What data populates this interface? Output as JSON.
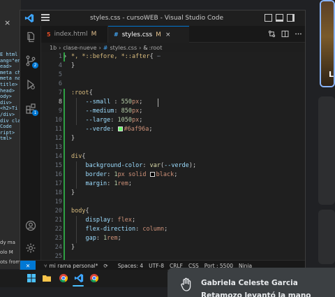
{
  "window": {
    "title": "styles.css - cursoWEB - Visual Studio Code"
  },
  "background_left": {
    "tab_close": "×",
    "code_snippets": [
      "E html",
      "ang=\"en",
      "ead>",
      "meta ch",
      "meta na",
      "title>",
      "head>",
      "ody>",
      "div>",
      "<h2>Ti",
      "/div>",
      "div cla",
      " Code",
      "ript>",
      "tml>"
    ],
    "bottom_texts": [
      "dy  ma",
      "olo  M",
      "ots from t"
    ]
  },
  "tabs": [
    {
      "label": "index.html",
      "modified": "M",
      "icon": "html-file-icon",
      "icon_glyph": "5",
      "icon_color": "#e44d26"
    },
    {
      "label": "styles.css",
      "modified": "M",
      "icon": "css-file-icon",
      "icon_glyph": "#",
      "icon_color": "#42a5f5",
      "close": "×"
    }
  ],
  "breadcrumb": {
    "items": [
      "1b",
      "clase-nueve",
      "styles.css",
      ":root"
    ],
    "sep": "›",
    "css_hash": "#",
    "selector_icon": "&"
  },
  "editor": {
    "active_line": 8,
    "lines": [
      {
        "n": "1",
        "parts": [
          [
            "tok-sel",
            "*, *::before, *::after"
          ],
          [
            "tok-punc",
            "{"
          ],
          [
            "tok-fold",
            " ⋯"
          ]
        ]
      },
      {
        "n": "4",
        "parts": [
          [
            "tok-punc",
            "}"
          ]
        ]
      },
      {
        "n": "5",
        "parts": []
      },
      {
        "n": "6",
        "parts": []
      },
      {
        "n": "7",
        "parts": [
          [
            "tok-sel",
            ":root"
          ],
          [
            "tok-punc",
            "{"
          ]
        ]
      },
      {
        "n": "8",
        "parts": [
          [
            "tok-prop",
            "    --small"
          ],
          [
            "tok-punc",
            " : "
          ],
          [
            "tok-num",
            "550"
          ],
          [
            "tok-val",
            "px"
          ],
          [
            "tok-punc",
            ";"
          ]
        ]
      },
      {
        "n": "9",
        "parts": [
          [
            "tok-prop",
            "    --medium"
          ],
          [
            "tok-punc",
            ": "
          ],
          [
            "tok-num",
            "850"
          ],
          [
            "tok-val",
            "px"
          ],
          [
            "tok-punc",
            ";"
          ]
        ]
      },
      {
        "n": "10",
        "parts": [
          [
            "tok-prop",
            "    --large"
          ],
          [
            "tok-punc",
            ": "
          ],
          [
            "tok-num",
            "1050"
          ],
          [
            "tok-val",
            "px"
          ],
          [
            "tok-punc",
            ";"
          ]
        ]
      },
      {
        "n": "11",
        "parts": [
          [
            "tok-prop",
            "    --verde"
          ],
          [
            "tok-punc",
            ": "
          ],
          [
            "swatch",
            "#6af96a"
          ],
          [
            "tok-val",
            "#6af96a"
          ],
          [
            "tok-punc",
            ";"
          ]
        ]
      },
      {
        "n": "12",
        "parts": [
          [
            "tok-punc",
            "}"
          ]
        ]
      },
      {
        "n": "13",
        "parts": []
      },
      {
        "n": "14",
        "parts": [
          [
            "tok-sel",
            "div"
          ],
          [
            "tok-punc",
            "{"
          ]
        ]
      },
      {
        "n": "15",
        "parts": [
          [
            "tok-prop",
            "    background-color"
          ],
          [
            "tok-punc",
            ": "
          ],
          [
            "tok-fn",
            "var"
          ],
          [
            "tok-punc",
            "("
          ],
          [
            "tok-prop",
            "--verde"
          ],
          [
            "tok-punc",
            ");"
          ]
        ]
      },
      {
        "n": "16",
        "parts": [
          [
            "tok-prop",
            "    border"
          ],
          [
            "tok-punc",
            ": "
          ],
          [
            "tok-num",
            "1"
          ],
          [
            "tok-val",
            "px solid "
          ],
          [
            "swatch",
            "#000000"
          ],
          [
            "tok-val",
            "black"
          ],
          [
            "tok-punc",
            ";"
          ]
        ]
      },
      {
        "n": "17",
        "parts": [
          [
            "tok-prop",
            "    margin"
          ],
          [
            "tok-punc",
            ": "
          ],
          [
            "tok-num",
            "1"
          ],
          [
            "tok-val",
            "rem"
          ],
          [
            "tok-punc",
            ";"
          ]
        ]
      },
      {
        "n": "18",
        "parts": [
          [
            "tok-punc",
            "}"
          ]
        ]
      },
      {
        "n": "19",
        "parts": []
      },
      {
        "n": "20",
        "parts": [
          [
            "tok-sel",
            "body"
          ],
          [
            "tok-punc",
            "{"
          ]
        ]
      },
      {
        "n": "21",
        "parts": [
          [
            "tok-prop",
            "    display"
          ],
          [
            "tok-punc",
            ": "
          ],
          [
            "tok-val",
            "flex"
          ],
          [
            "tok-punc",
            ";"
          ]
        ]
      },
      {
        "n": "22",
        "parts": [
          [
            "tok-prop",
            "    flex-direction"
          ],
          [
            "tok-punc",
            ": "
          ],
          [
            "tok-val",
            "column"
          ],
          [
            "tok-punc",
            ";"
          ]
        ]
      },
      {
        "n": "23",
        "parts": [
          [
            "tok-prop",
            "    gap"
          ],
          [
            "tok-punc",
            ": "
          ],
          [
            "tok-num",
            "1"
          ],
          [
            "tok-val",
            "rem"
          ],
          [
            "tok-punc",
            ";"
          ]
        ]
      },
      {
        "n": "24",
        "parts": [
          [
            "tok-punc",
            "}"
          ]
        ]
      },
      {
        "n": "25",
        "parts": []
      }
    ]
  },
  "statusbar": {
    "remote": "✕",
    "branch": "mi rama personal*",
    "sync": "⟳",
    "spaces": "Spaces: 4",
    "encoding": "UTF-8",
    "eol": "CRLF",
    "language": "CSS",
    "port": "Port : 5500",
    "prettier": "Ninja"
  },
  "activity_badges": {
    "source_control": "2",
    "extensions": "1"
  },
  "right_thumb_letter": "L",
  "notification": {
    "text": "Gabriela Celeste Garcia Retamozo levantó la mano"
  },
  "colors": {
    "accent": "#0078d4",
    "verde": "#6af96a",
    "selection_border": "#8ab4f8"
  }
}
